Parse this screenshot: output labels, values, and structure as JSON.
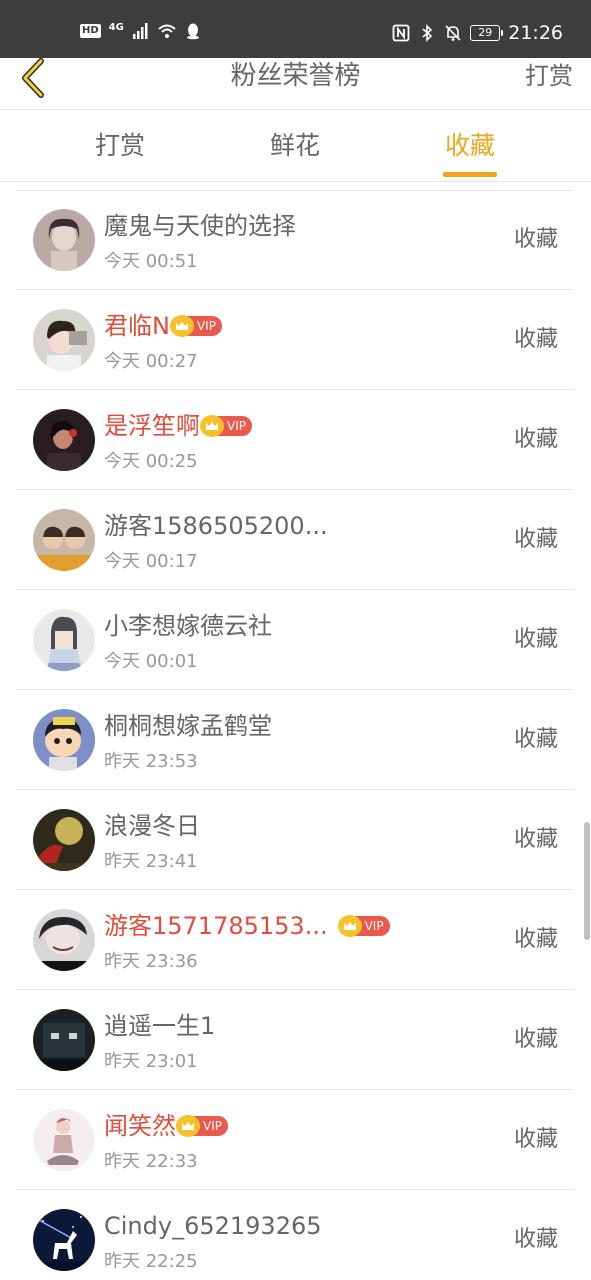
{
  "status_bar": {
    "hd": "HD",
    "network": "4G",
    "battery": "29",
    "time": "21:26"
  },
  "header": {
    "title": "粉丝荣誉榜",
    "action_label": "打赏"
  },
  "tabs": [
    {
      "label": "打赏",
      "active": false
    },
    {
      "label": "鲜花",
      "active": false
    },
    {
      "label": "收藏",
      "active": true
    }
  ],
  "accent_color": "#f0a51d",
  "vip_name_color": "#e24d3b",
  "fans": [
    {
      "name": "魔鬼与天使的选择",
      "time": "今天 00:51",
      "vip": false,
      "vip_label": "",
      "action": "收藏"
    },
    {
      "name": "君临N",
      "time": "今天 00:27",
      "vip": true,
      "vip_label": "VIP",
      "action": "收藏"
    },
    {
      "name": "是浮笙啊",
      "time": "今天 00:25",
      "vip": true,
      "vip_label": "VIP",
      "action": "收藏"
    },
    {
      "name": "游客1586505200...",
      "time": "今天 00:17",
      "vip": false,
      "vip_label": "",
      "action": "收藏"
    },
    {
      "name": "小李想嫁德云社",
      "time": "今天 00:01",
      "vip": false,
      "vip_label": "",
      "action": "收藏"
    },
    {
      "name": "桐桐想嫁孟鹤堂",
      "time": "昨天 23:53",
      "vip": false,
      "vip_label": "",
      "action": "收藏"
    },
    {
      "name": "浪漫冬日",
      "time": "昨天 23:41",
      "vip": false,
      "vip_label": "",
      "action": "收藏"
    },
    {
      "name": "游客1571785153...",
      "time": "昨天 23:36",
      "vip": true,
      "vip_label": "VIP",
      "action": "收藏"
    },
    {
      "name": "逍遥一生1",
      "time": "昨天 23:01",
      "vip": false,
      "vip_label": "",
      "action": "收藏"
    },
    {
      "name": "闻笑然",
      "time": "昨天 22:33",
      "vip": true,
      "vip_label": "VIP",
      "action": "收藏"
    },
    {
      "name": "Cindy_652193265",
      "time": "昨天 22:25",
      "vip": false,
      "vip_label": "",
      "action": "收藏"
    }
  ]
}
